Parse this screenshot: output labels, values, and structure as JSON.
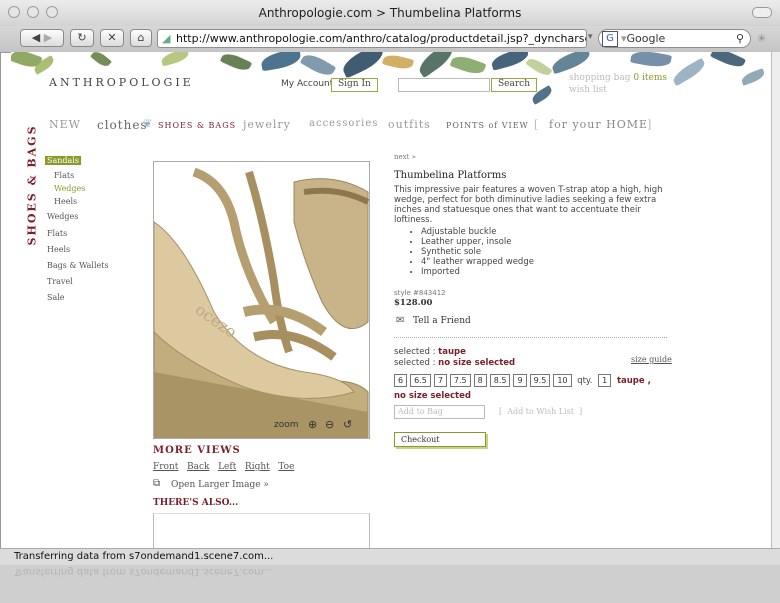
{
  "window": {
    "title": "Anthropologie.com > Thumbelina Platforms",
    "url": "http://www.anthropologie.com/anthro/catalog/productdetail.jsp?_dyncharset=ISO-8859",
    "search_text": "Google",
    "status_text": "Transferring data from s7ondemand1.scene7.com..."
  },
  "header": {
    "logo": "ANTHROPOLOGIE",
    "my_account": "My Account",
    "sign_in": "Sign In",
    "search_button": "Search",
    "shopping_bag": "shopping bag",
    "bag_count": "0 items",
    "wish_list": "wish list"
  },
  "nav": [
    "NEW",
    "clothes",
    "SHOES & BAGS",
    "jewelry",
    "accessories",
    "outfits",
    "POINTS of VIEW",
    "for your HOME"
  ],
  "sidebar": {
    "section": "SHOES & BAGS",
    "items": [
      "Sandals",
      "Flats",
      "Wedges",
      "Heels",
      "Wedges",
      "Flats",
      "Heels",
      "Bags & Wallets",
      "Travel",
      "Sale"
    ]
  },
  "product": {
    "next": "next »",
    "name": "Thumbelina Platforms",
    "description": "This impressive pair features a woven T-strap atop a high, high wedge, perfect for both diminutive ladies seeking a few extra inches and statuesque ones that want to accentuate their loftiness.",
    "features": [
      "Adjustable buckle",
      "Leather upper, insole",
      "Synthetic sole",
      "4\" leather wrapped wedge",
      "Imported"
    ],
    "style": "style #843412",
    "price": "$128.00",
    "tell_friend": "Tell a Friend",
    "selected_label": "selected :",
    "selected_color": "taupe",
    "selected_size": "no size selected",
    "size_guide": "size guide",
    "sizes": [
      "6",
      "6.5",
      "7",
      "7.5",
      "8",
      "8.5",
      "9",
      "9.5",
      "10"
    ],
    "qty_label": "qty.",
    "qty": "1",
    "summary_color": "taupe ,",
    "summary_size": "no size selected",
    "add_to_bag": "Add to Bag",
    "add_to_wish": "Add to Wish List",
    "checkout": "Checkout"
  },
  "image": {
    "zoom_label": "zoom"
  },
  "more_views": {
    "title": "MORE VIEWS",
    "views": [
      "Front",
      "Back",
      "Left",
      "Right",
      "Toe"
    ],
    "open_larger": "Open Larger Image »",
    "theres_also": "THERE'S ALSO..."
  },
  "colors": {
    "maroon": "#7a1f2b",
    "olive": "#8a9a2a",
    "taupe": "#b9a47a"
  }
}
